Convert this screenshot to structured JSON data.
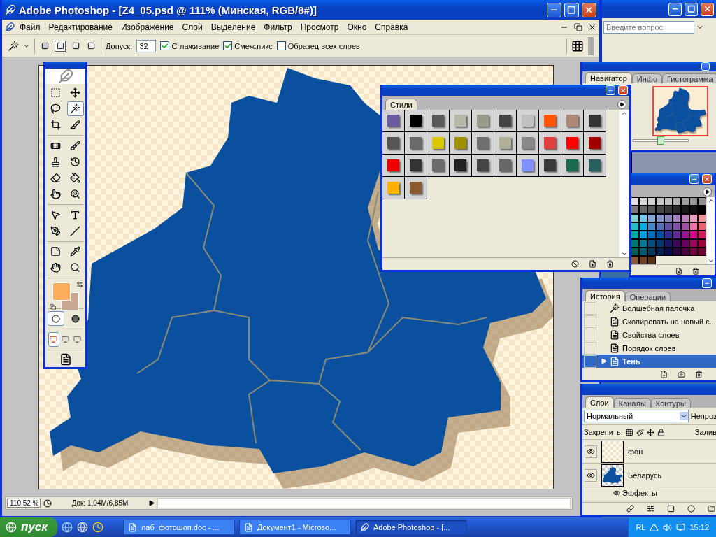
{
  "window": {
    "title": "Adobe Photoshop - [Z4_05.psd @ 111% (Минская, RGB/8#)]"
  },
  "menu": [
    "Файл",
    "Редактирование",
    "Изображение",
    "Слой",
    "Выделение",
    "Фильтр",
    "Просмотр",
    "Окно",
    "Справка"
  ],
  "background_window": {
    "help_field": {
      "placeholder": "Введите вопрос"
    }
  },
  "options_bar": {
    "selection_modes": [
      {
        "selected": false
      },
      {
        "selected": true
      },
      {
        "selected": false
      },
      {
        "selected": false
      }
    ],
    "tolerance_label": "Допуск:",
    "tolerance": "32",
    "checks": [
      {
        "label": "Сглаживание",
        "checked": true
      },
      {
        "label": "Смеж.пикс",
        "checked": true
      },
      {
        "label": "Образец всех слоев",
        "checked": false
      }
    ]
  },
  "toolbox": {
    "tools": [
      {
        "kind": "marquee",
        "selected": false
      },
      {
        "kind": "move",
        "selected": false
      },
      {
        "kind": "lasso",
        "selected": false
      },
      {
        "kind": "wand",
        "selected": true
      },
      {
        "kind": "crop",
        "selected": false
      },
      {
        "kind": "slice",
        "selected": false
      },
      {
        "kind": "heal",
        "selected": false
      },
      {
        "kind": "brush",
        "selected": false
      },
      {
        "kind": "stamp",
        "selected": false
      },
      {
        "kind": "history",
        "selected": false
      },
      {
        "kind": "eraser",
        "selected": false
      },
      {
        "kind": "bucket",
        "selected": false
      },
      {
        "kind": "smudge",
        "selected": false
      },
      {
        "kind": "dodge",
        "selected": false
      },
      {
        "kind": "path",
        "selected": false
      },
      {
        "kind": "type",
        "selected": false
      },
      {
        "kind": "pen",
        "selected": false
      },
      {
        "kind": "line",
        "selected": false
      },
      {
        "kind": "notes",
        "selected": false
      },
      {
        "kind": "eyedropper",
        "selected": false
      },
      {
        "kind": "hand",
        "selected": false
      },
      {
        "kind": "zoom",
        "selected": false
      }
    ],
    "foreground": {
      "color": "#fbad5e"
    },
    "background": {
      "color": "#c9a68f"
    },
    "mask_modes": [
      {
        "selected": true
      },
      {
        "selected": false
      }
    ],
    "screen_modes": [
      {
        "selected": true
      },
      {
        "selected": false
      },
      {
        "selected": false
      }
    ]
  },
  "styles_palette": {
    "tab": "Стили",
    "swatches": [
      {
        "color": "#6a5aa0"
      },
      {
        "color": "#000000"
      },
      {
        "color": "#5a5a5a"
      },
      {
        "color": "#b8b8a8"
      },
      {
        "color": "#9a9a88"
      },
      {
        "color": "#444444"
      },
      {
        "color": "#c0c0c0"
      },
      {
        "color": "#ff5500"
      },
      {
        "color": "#b08878"
      },
      {
        "color": "#333333"
      },
      {
        "color": "#555555"
      },
      {
        "color": "#6a6a6a"
      },
      {
        "color": "#d8c800"
      },
      {
        "color": "#a09000"
      },
      {
        "color": "#707070"
      },
      {
        "color": "#b0b098"
      },
      {
        "color": "#888888"
      },
      {
        "color": "#e04040"
      },
      {
        "color": "#ff0000"
      },
      {
        "color": "#a00000"
      },
      {
        "color": "#ee0000"
      },
      {
        "color": "#343434"
      },
      {
        "color": "#6b6b6b"
      },
      {
        "color": "#222222"
      },
      {
        "color": "#454545"
      },
      {
        "color": "#676767"
      },
      {
        "color": "#8090ff"
      },
      {
        "color": "#3a3a3a"
      },
      {
        "color": "#1a6a50"
      },
      {
        "color": "#2a6060"
      },
      {
        "color": "#ffb000"
      },
      {
        "color": "#8a5a30"
      }
    ]
  },
  "navigator": {
    "tabs": [
      {
        "label": "Навигатор",
        "selected": true
      },
      {
        "label": "Инфо",
        "selected": false
      },
      {
        "label": "Гистограмма",
        "selected": false
      }
    ],
    "zoom": {
      "level": 0.5
    }
  },
  "swatches_palette": {
    "colors": [
      {
        "color": "#e0e0e0"
      },
      {
        "color": "#d8d8d8"
      },
      {
        "color": "#d0d0d0"
      },
      {
        "color": "#c8c8c8"
      },
      {
        "color": "#c0c0c0"
      },
      {
        "color": "#b0b0b0"
      },
      {
        "color": "#a0a0a0"
      },
      {
        "color": "#989898"
      },
      {
        "color": "#909090"
      },
      {
        "color": "#787878"
      },
      {
        "color": "#686868"
      },
      {
        "color": "#585858"
      },
      {
        "color": "#484848"
      },
      {
        "color": "#383838"
      },
      {
        "color": "#282828"
      },
      {
        "color": "#181818"
      },
      {
        "color": "#101010"
      },
      {
        "color": "#000000"
      },
      {
        "color": "#80d0d0"
      },
      {
        "color": "#70c8f0"
      },
      {
        "color": "#80a8d8"
      },
      {
        "color": "#8090c8"
      },
      {
        "color": "#8880c0"
      },
      {
        "color": "#a080c0"
      },
      {
        "color": "#c080c0"
      },
      {
        "color": "#f0a0c0"
      },
      {
        "color": "#f09898"
      },
      {
        "color": "#20c0c0"
      },
      {
        "color": "#00b0e8"
      },
      {
        "color": "#4088c8"
      },
      {
        "color": "#5070b8"
      },
      {
        "color": "#6050a8"
      },
      {
        "color": "#8050a8"
      },
      {
        "color": "#a050a0"
      },
      {
        "color": "#f070a8"
      },
      {
        "color": "#f06070"
      },
      {
        "color": "#00a8a0"
      },
      {
        "color": "#00a0e0"
      },
      {
        "color": "#0070b8"
      },
      {
        "color": "#0050a0"
      },
      {
        "color": "#303090"
      },
      {
        "color": "#602890"
      },
      {
        "color": "#901890"
      },
      {
        "color": "#e00090"
      },
      {
        "color": "#e01860"
      },
      {
        "color": "#007870"
      },
      {
        "color": "#007898"
      },
      {
        "color": "#005080"
      },
      {
        "color": "#003870"
      },
      {
        "color": "#181868"
      },
      {
        "color": "#400860"
      },
      {
        "color": "#680060"
      },
      {
        "color": "#a00060"
      },
      {
        "color": "#a00040"
      },
      {
        "color": "#005850"
      },
      {
        "color": "#005870"
      },
      {
        "color": "#003860"
      },
      {
        "color": "#002050"
      },
      {
        "color": "#080850"
      },
      {
        "color": "#280040"
      },
      {
        "color": "#480040"
      },
      {
        "color": "#700040"
      },
      {
        "color": "#700030"
      },
      {
        "color": "#8a5a30"
      },
      {
        "color": "#704020"
      },
      {
        "color": "#583010"
      }
    ]
  },
  "history": {
    "tabs": [
      {
        "label": "История",
        "selected": true
      },
      {
        "label": "Операции",
        "selected": false
      }
    ],
    "items": [
      {
        "kind": "wand",
        "label": "Волшебная палочка",
        "selected": false
      },
      {
        "kind": "step",
        "label": "Скопировать на новый с...",
        "selected": false
      },
      {
        "kind": "step",
        "label": "Свойства слоев",
        "selected": false
      },
      {
        "kind": "step",
        "label": "Порядок слоев",
        "selected": false
      },
      {
        "kind": "step",
        "label": "Тень",
        "selected": true
      }
    ]
  },
  "layers": {
    "tabs": [
      {
        "label": "Слои",
        "selected": true
      },
      {
        "label": "Каналы",
        "selected": false
      },
      {
        "label": "Контуры",
        "selected": false
      }
    ],
    "blend_mode": "Нормальный",
    "opacity_label": "Непроз",
    "lock_label": "Закрепить:",
    "fill_label": "Залив",
    "items": [
      {
        "kind": "transparent",
        "name": "фон",
        "visible": true
      },
      {
        "kind": "map",
        "name": "Беларусь",
        "visible": true,
        "effects": "Эффекты"
      }
    ]
  },
  "status_bar": {
    "zoom": "110,52 %",
    "doc_size": "Док: 1,04M/6,85M"
  },
  "taskbar": {
    "start": "пуск",
    "tasks": [
      {
        "label": "лаб_фотошоп.doc - ...",
        "kind": "word",
        "selected": false
      },
      {
        "label": "Документ1 - Microso...",
        "kind": "word",
        "selected": false
      },
      {
        "label": "Adobe Photoshop - [...",
        "kind": "photoshop",
        "selected": true
      }
    ],
    "language": "RL",
    "clock": "15:12"
  }
}
